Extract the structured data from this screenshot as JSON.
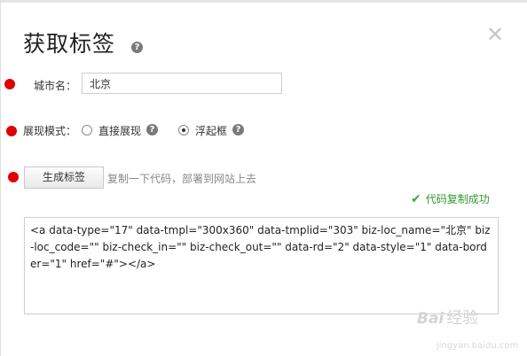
{
  "dialog": {
    "title": "获取标签",
    "help_glyph": "?",
    "close_glyph": "✕"
  },
  "form": {
    "city": {
      "label": "城市名：",
      "value": "北京"
    },
    "mode": {
      "label": "展现模式：",
      "options": [
        {
          "label": "直接展现",
          "selected": false
        },
        {
          "label": "浮起框",
          "selected": true
        }
      ]
    }
  },
  "generate": {
    "button_label": "生成标签",
    "hint": "复制一下代码，部署到网站上去"
  },
  "status": {
    "check_glyph": "✔",
    "success_text": "代码复制成功"
  },
  "code": {
    "text": "<a data-type=\"17\" data-tmpl=\"300x360\" data-tmplid=\"303\" biz-loc_name=\"北京\" biz-loc_code=\"\" biz-check_in=\"\" biz-check_out=\"\" data-rd=\"2\" data-style=\"1\" data-border=\"1\" href=\"#\"></a>"
  },
  "watermark": {
    "logo": "Bai",
    "text": "经验",
    "url": "jingyan.baidu.com"
  },
  "colors": {
    "bullet": "#e00000",
    "success": "#2e9a2e"
  }
}
